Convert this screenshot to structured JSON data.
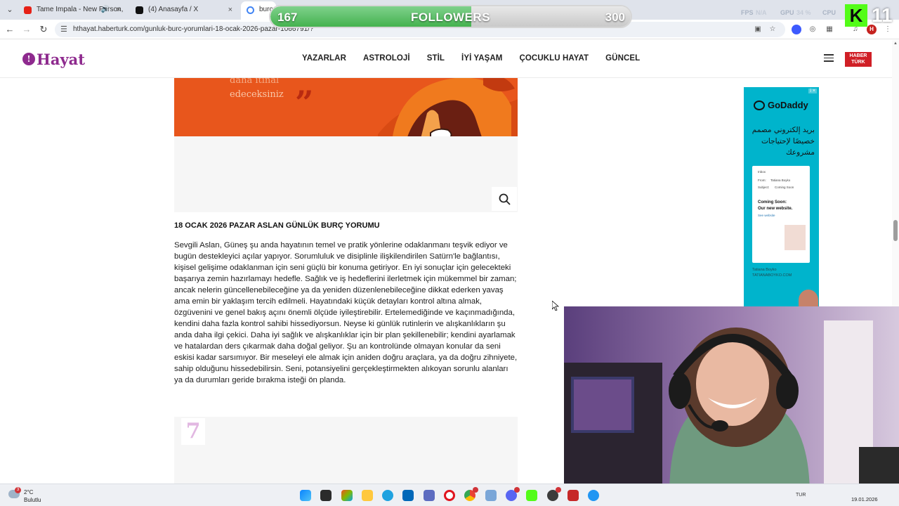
{
  "browser": {
    "tabs": [
      {
        "title": "Tame Impala - New Person,",
        "icon": "youtube-icon",
        "audio": "🔊",
        "close": "×"
      },
      {
        "title": "(4) Anasayfa / X",
        "icon": "x-icon",
        "close": "×"
      },
      {
        "title": "burç",
        "icon": "google-icon"
      }
    ],
    "tab_dropdown": "⌄",
    "nav": {
      "back": "←",
      "forward": "→",
      "reload": "↻"
    },
    "url": "hthayat.haberturk.com/gunluk-burc-yorumlari-18-ocak-2026-pazar-1066791/?",
    "profile_initial": "H"
  },
  "site": {
    "logo_text": "Hayat",
    "logo_mark": "!",
    "nav": [
      "YAZARLAR",
      "ASTROLOJİ",
      "STİL",
      "İYİ YAŞAM",
      "ÇOCUKLU HAYAT",
      "GÜNCEL"
    ],
    "partner_logo_top": "HABER",
    "partner_logo_bottom": "TÜRK"
  },
  "article": {
    "hero_text": [
      "daha itinal",
      "edeceksiniz"
    ],
    "hero_quote_mark": "”",
    "title": "18 OCAK 2026 PAZAR ASLAN GÜNLÜK BURÇ YORUMU",
    "body": "Sevgili Aslan, Güneş şu anda hayatının temel ve pratik yönlerine odaklanmanı teşvik ediyor ve bugün destekleyici açılar yapıyor. Sorumluluk ve disiplinle ilişkilendirilen Satürn'le bağlantısı, kişisel gelişime odaklanman için seni güçlü bir konuma getiriyor. En iyi sonuçlar için gelecekteki başarıya zemin hazırlamayı hedefle. Sağlık ve iş hedeflerini ilerletmek için mükemmel bir zaman; ancak nelerin güncellenebileceğine ya da yeniden düzenlenebileceğine dikkat ederken yavaş ama emin bir yaklaşım tercih edilmeli. Hayatındaki küçük detayları kontrol altına almak, özgüvenini ve genel bakış açını önemli ölçüde iyileştirebilir. Ertelemediğinde ve kaçınmadığında, kendini daha fazla kontrol sahibi hissediyorsun. Neyse ki günlük rutinlerin ve alışkanlıkların şu anda daha ilgi çekici. Daha iyi sağlık ve alışkanlıklar için bir plan şekillenebilir; kendini ayarlamak ve hatalardan ders çıkarmak daha doğal geliyor. Şu an kontrolünde olmayan konular da seni eskisi kadar sarsımıyor. Bir meseleyi ele almak için aniden doğru araçlara, ya da doğru zihniyete, sahip olduğunu hissedebilirsin. Seni, potansiyelini gerçekleştirmekten alıkoyan sorunlu alanları ya da durumları geride bırakma isteği ön planda.",
    "next_number": "7"
  },
  "ad": {
    "brand": "GoDaddy",
    "arabic": "بريد إلكتروني مصمم خصيصًا لإحتياجات مشروعك",
    "card_inbox": "Inbox",
    "card_from": "From:",
    "card_from_name": "Tatiana Boyko",
    "card_subject": "Subject:",
    "card_subject_text": "Coming Soon",
    "card_headline": "Coming Soon:",
    "card_headline2": "Our new website.",
    "card_link": "See website",
    "credit_name": "Tatiana Boyko",
    "credit_site": "TATIANABOYKO.COM",
    "badge": "i ×"
  },
  "overlay": {
    "followers_current": "167",
    "followers_label": "FOLLOWERS",
    "followers_goal": "300",
    "followers_progress": 0.557,
    "fps_label": "FPS",
    "fps_value": "N/A",
    "gpu_label": "GPU",
    "gpu_value": "34 %",
    "cpu_label": "CPU",
    "kick_letter": "K",
    "kick_number": "11"
  },
  "taskbar": {
    "weather_temp": "2°C",
    "weather_cond": "Bulutlu",
    "weather_badge": "3",
    "lang": "TUR",
    "date": "19.01.2026"
  },
  "colors": {
    "brand_purple": "#8e2a8e",
    "haberturk_red": "#d01f26",
    "hero_orange": "#e8561c",
    "ad_teal": "#00b4cc",
    "followers_green": "#45b24f",
    "kick_green": "#53fc18"
  }
}
